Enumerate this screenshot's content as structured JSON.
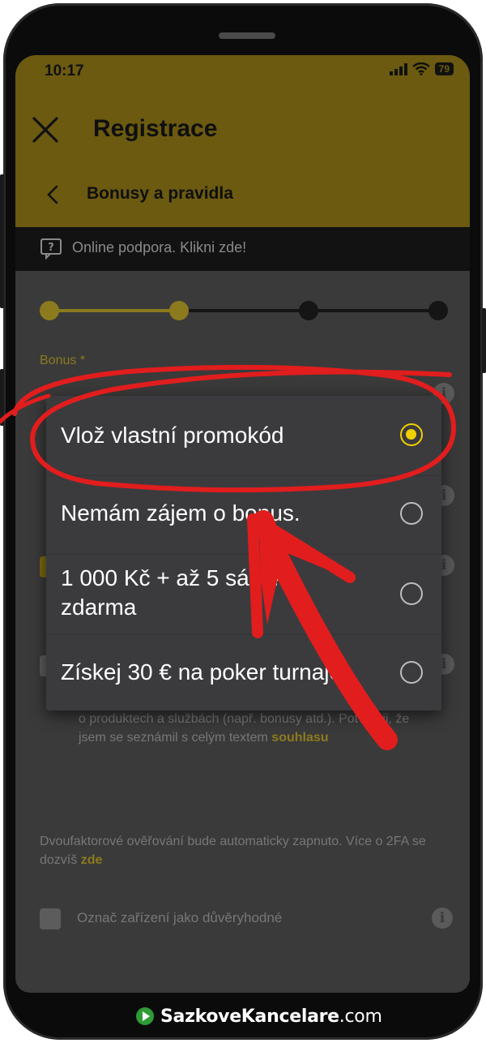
{
  "status_bar": {
    "time": "10:17",
    "battery": "79"
  },
  "header": {
    "title": "Registrace",
    "subtitle": "Bonusy a pravidla"
  },
  "support": {
    "text": "Online podpora. Klikni zde!"
  },
  "form": {
    "bonus_label": "Bonus *",
    "bonus_value": "Vlož vlastní promokód",
    "consent_text": "aktivit včetně zasílání marketingových zpráv a informování o produktech a službách (např. bonusy atd.). Potvrzuji, že jsem se seznámil s celým textem",
    "consent_link": "souhlasu",
    "twofa_text": "Dvoufaktorové ověřování bude automaticky zapnuto. Více o 2FA se dozvíš",
    "twofa_link": "zde",
    "trusted_device_label": "Označ zařízení jako důvěryhodné",
    "info_symbol": "i"
  },
  "stepper": {
    "total_steps": 4,
    "current_step": 2
  },
  "dropdown": {
    "options": [
      {
        "label": "Vlož vlastní promokód",
        "selected": true
      },
      {
        "label": "Nemám zájem o bonus.",
        "selected": false
      },
      {
        "label": "1 000 Kč + až 5 sázek\nzdarma",
        "selected": false
      },
      {
        "label": "Získej 30 € na poker turnaje",
        "selected": false
      }
    ]
  },
  "watermark": {
    "brand": "SazkoveKancelare",
    "tld": ".com"
  },
  "colors": {
    "accent": "#f0d000",
    "header_dimmed": "#6b5a10",
    "annotation_red": "#e11d1d"
  }
}
